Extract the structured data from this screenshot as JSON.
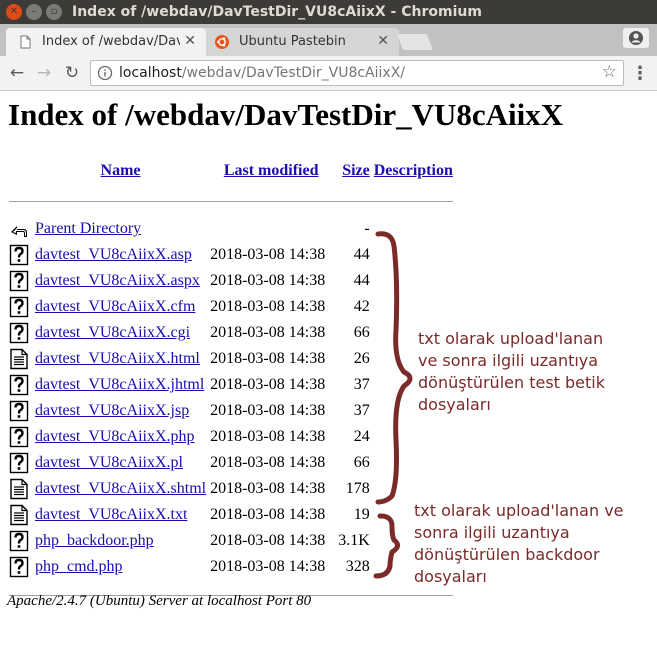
{
  "window": {
    "title": "Index of /webdav/DavTestDir_VU8cAiixX - Chromium"
  },
  "tabs": [
    {
      "label": "Index of /webdav/DavT",
      "active": true,
      "icon": "page-icon"
    },
    {
      "label": "Ubuntu Pastebin",
      "active": false,
      "icon": "ubuntu-icon"
    }
  ],
  "toolbar": {
    "url_host": "localhost",
    "url_path": "/webdav/DavTestDir_VU8cAiixX/"
  },
  "page": {
    "heading": "Index of /webdav/DavTestDir_VU8cAiixX",
    "columns": {
      "name": "Name",
      "modified": "Last modified",
      "size": "Size",
      "description": "Description"
    },
    "parent": {
      "name": "Parent Directory",
      "size": "-",
      "icon": "back-icon"
    },
    "files": [
      {
        "name": "davtest_VU8cAiixX.asp",
        "modified": "2018-03-08 14:38",
        "size": "44",
        "icon": "unknown-file-icon"
      },
      {
        "name": "davtest_VU8cAiixX.aspx",
        "modified": "2018-03-08 14:38",
        "size": "44",
        "icon": "unknown-file-icon"
      },
      {
        "name": "davtest_VU8cAiixX.cfm",
        "modified": "2018-03-08 14:38",
        "size": "42",
        "icon": "unknown-file-icon"
      },
      {
        "name": "davtest_VU8cAiixX.cgi",
        "modified": "2018-03-08 14:38",
        "size": "66",
        "icon": "unknown-file-icon"
      },
      {
        "name": "davtest_VU8cAiixX.html",
        "modified": "2018-03-08 14:38",
        "size": "26",
        "icon": "text-file-icon"
      },
      {
        "name": "davtest_VU8cAiixX.jhtml",
        "modified": "2018-03-08 14:38",
        "size": "37",
        "icon": "unknown-file-icon"
      },
      {
        "name": "davtest_VU8cAiixX.jsp",
        "modified": "2018-03-08 14:38",
        "size": "37",
        "icon": "unknown-file-icon"
      },
      {
        "name": "davtest_VU8cAiixX.php",
        "modified": "2018-03-08 14:38",
        "size": "24",
        "icon": "unknown-file-icon"
      },
      {
        "name": "davtest_VU8cAiixX.pl",
        "modified": "2018-03-08 14:38",
        "size": "66",
        "icon": "unknown-file-icon"
      },
      {
        "name": "davtest_VU8cAiixX.shtml",
        "modified": "2018-03-08 14:38",
        "size": "178",
        "icon": "text-file-icon"
      },
      {
        "name": "davtest_VU8cAiixX.txt",
        "modified": "2018-03-08 14:38",
        "size": "19",
        "icon": "text-file-icon"
      },
      {
        "name": "php_backdoor.php",
        "modified": "2018-03-08 14:38",
        "size": "3.1K",
        "icon": "unknown-file-icon"
      },
      {
        "name": "php_cmd.php",
        "modified": "2018-03-08 14:38",
        "size": "328",
        "icon": "unknown-file-icon"
      }
    ],
    "footer": "Apache/2.4.7 (Ubuntu) Server at localhost Port 80"
  },
  "annotations": {
    "test_files": [
      "txt olarak upload'lanan",
      "ve sonra ilgili uzantıya",
      "dönüştürülen test betik",
      "dosyaları"
    ],
    "backdoor_files": [
      "txt olarak upload'lanan ve",
      "sonra ilgili uzantıya",
      "dönüştürülen backdoor",
      "dosyaları"
    ],
    "color": "#7b2a2a"
  },
  "colors": {
    "link": "#1a0dab",
    "titlebar": "#3c3b37",
    "close_button": "#df4a16"
  }
}
